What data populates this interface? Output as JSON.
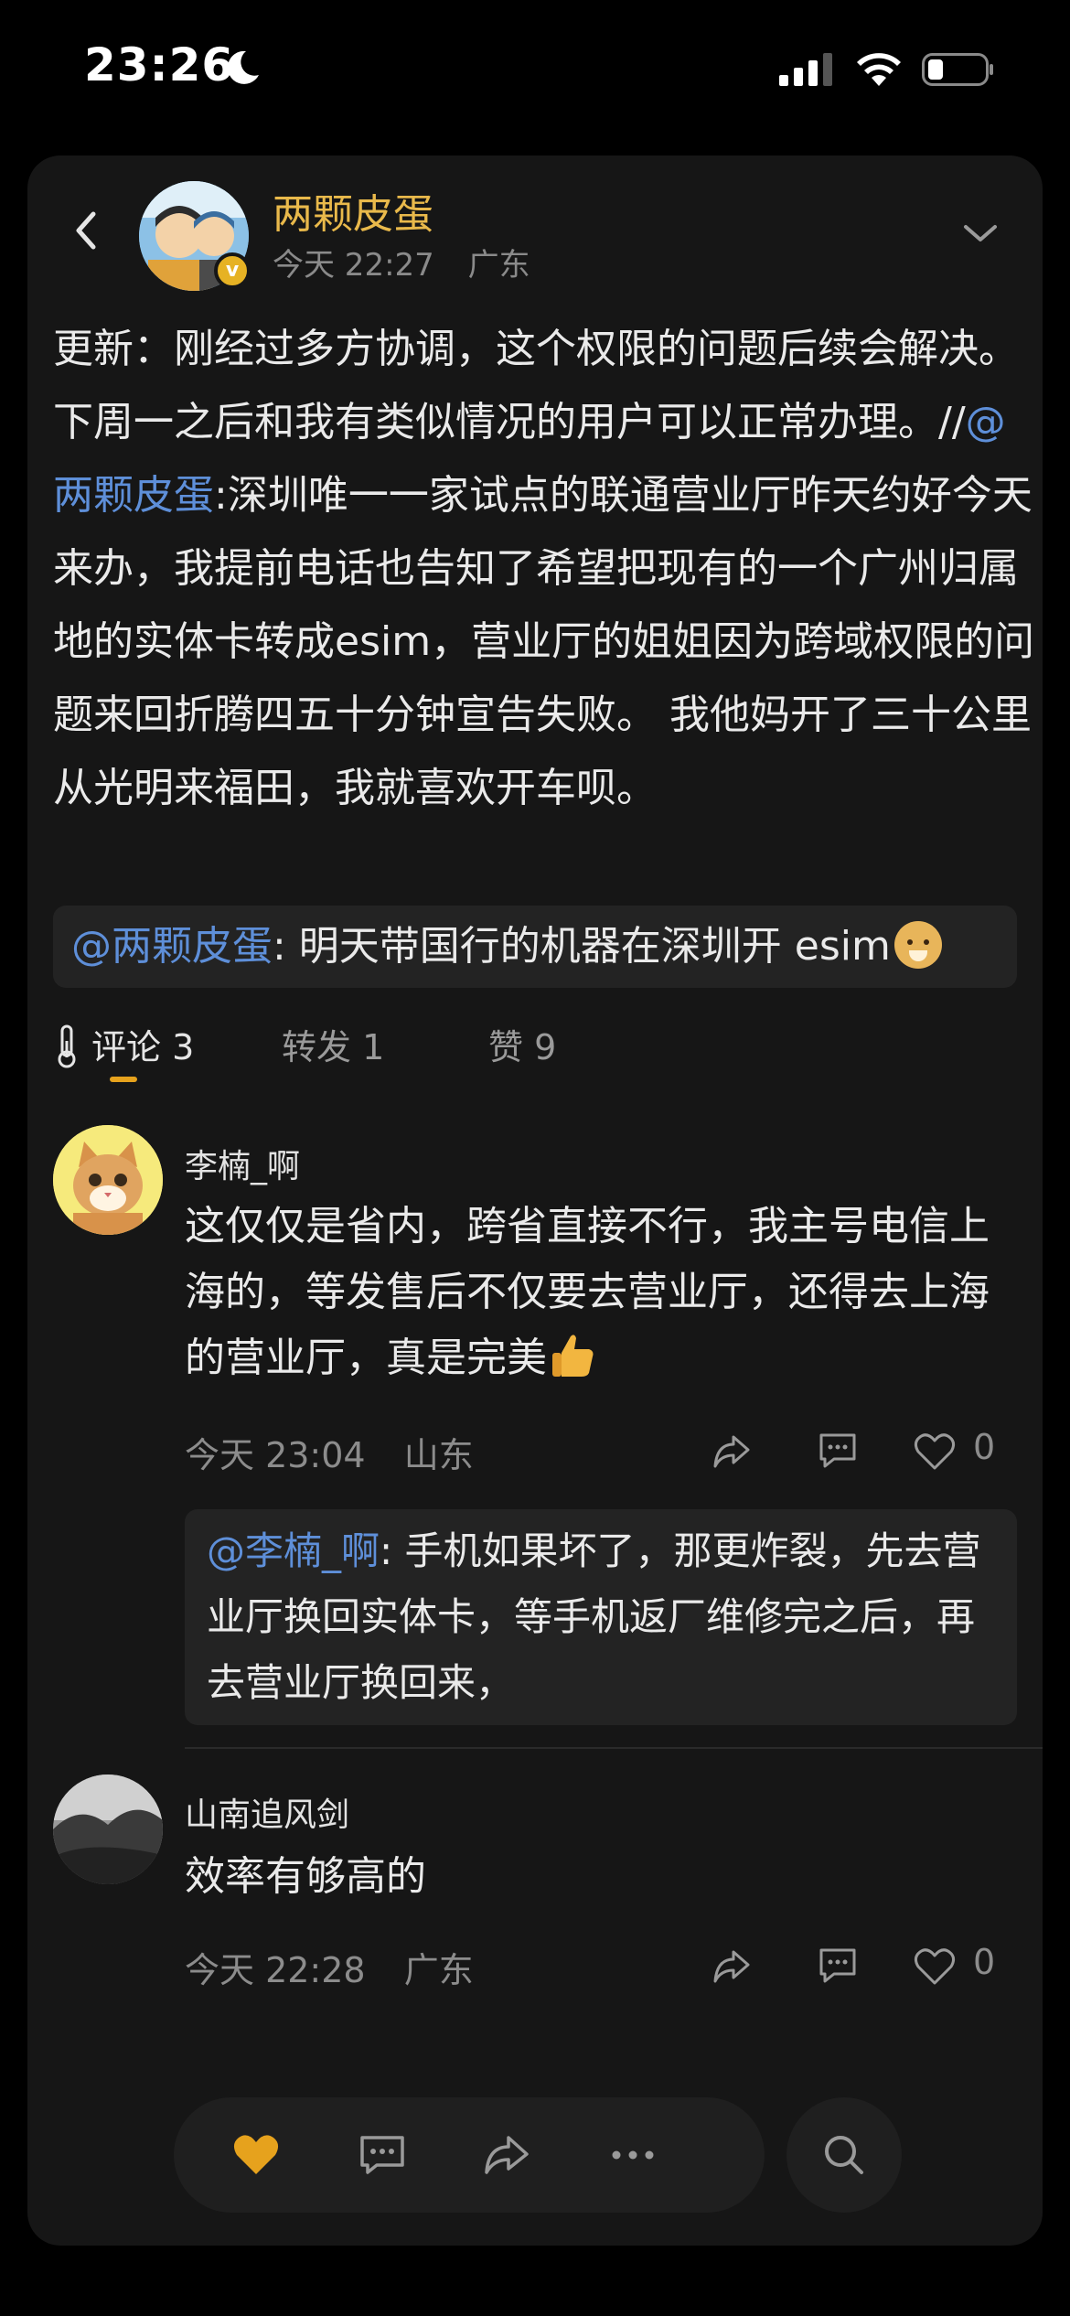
{
  "status_bar": {
    "time": "23:26"
  },
  "post": {
    "author": "两颗皮蛋",
    "time": "今天 22:27",
    "location": "广东",
    "body_part1": "更新：刚经过多方协调，这个权限的问题后续会解决。下周一之后和我有类似情况的用户可以正常办理。//",
    "body_mention": "@两颗皮蛋",
    "body_part2": ":深圳唯一一家试点的联通营业厅昨天约好今天来办，我提前电话也告知了希望把现有的一个广州归属地的实体卡转成esim，营业厅的姐姐因为跨域权限的问题来回折腾四五十分钟宣告失败。   我他妈开了三十公里从光明来福田，我就喜欢开车呗。",
    "repost_mention": "@两颗皮蛋",
    "repost_text": ": 明天带国行的机器在深圳开 esim"
  },
  "tabs": {
    "comments": "评论 3",
    "reposts": "转发 1",
    "likes": "赞 9"
  },
  "comments": [
    {
      "name": "李楠_啊",
      "text": "这仅仅是省内，跨省直接不行，我主号电信上海的，等发售后不仅要去营业厅，还得去上海的营业厅，真是完美",
      "time": "今天 23:04",
      "location": "山东",
      "likes": "0",
      "reply_mention": "@李楠_啊",
      "reply_text": ": 手机如果坏了，那更炸裂，先去营业厅换回实体卡，等手机返厂维修完之后，再去营业厅换回来，"
    },
    {
      "name": "山南追风剑",
      "text": "效率有够高的",
      "time": "今天 22:28",
      "location": "广东",
      "likes": "0"
    }
  ],
  "colors": {
    "accent": "#e6a21d",
    "author_name": "#e9b94b",
    "mention": "#5e8fd9",
    "background": "#000000",
    "card": "#161616"
  },
  "icons": [
    "back-icon",
    "chevron-down-icon",
    "thermometer-icon",
    "share-icon",
    "comment-icon",
    "heart-icon",
    "more-icon",
    "search-icon"
  ]
}
